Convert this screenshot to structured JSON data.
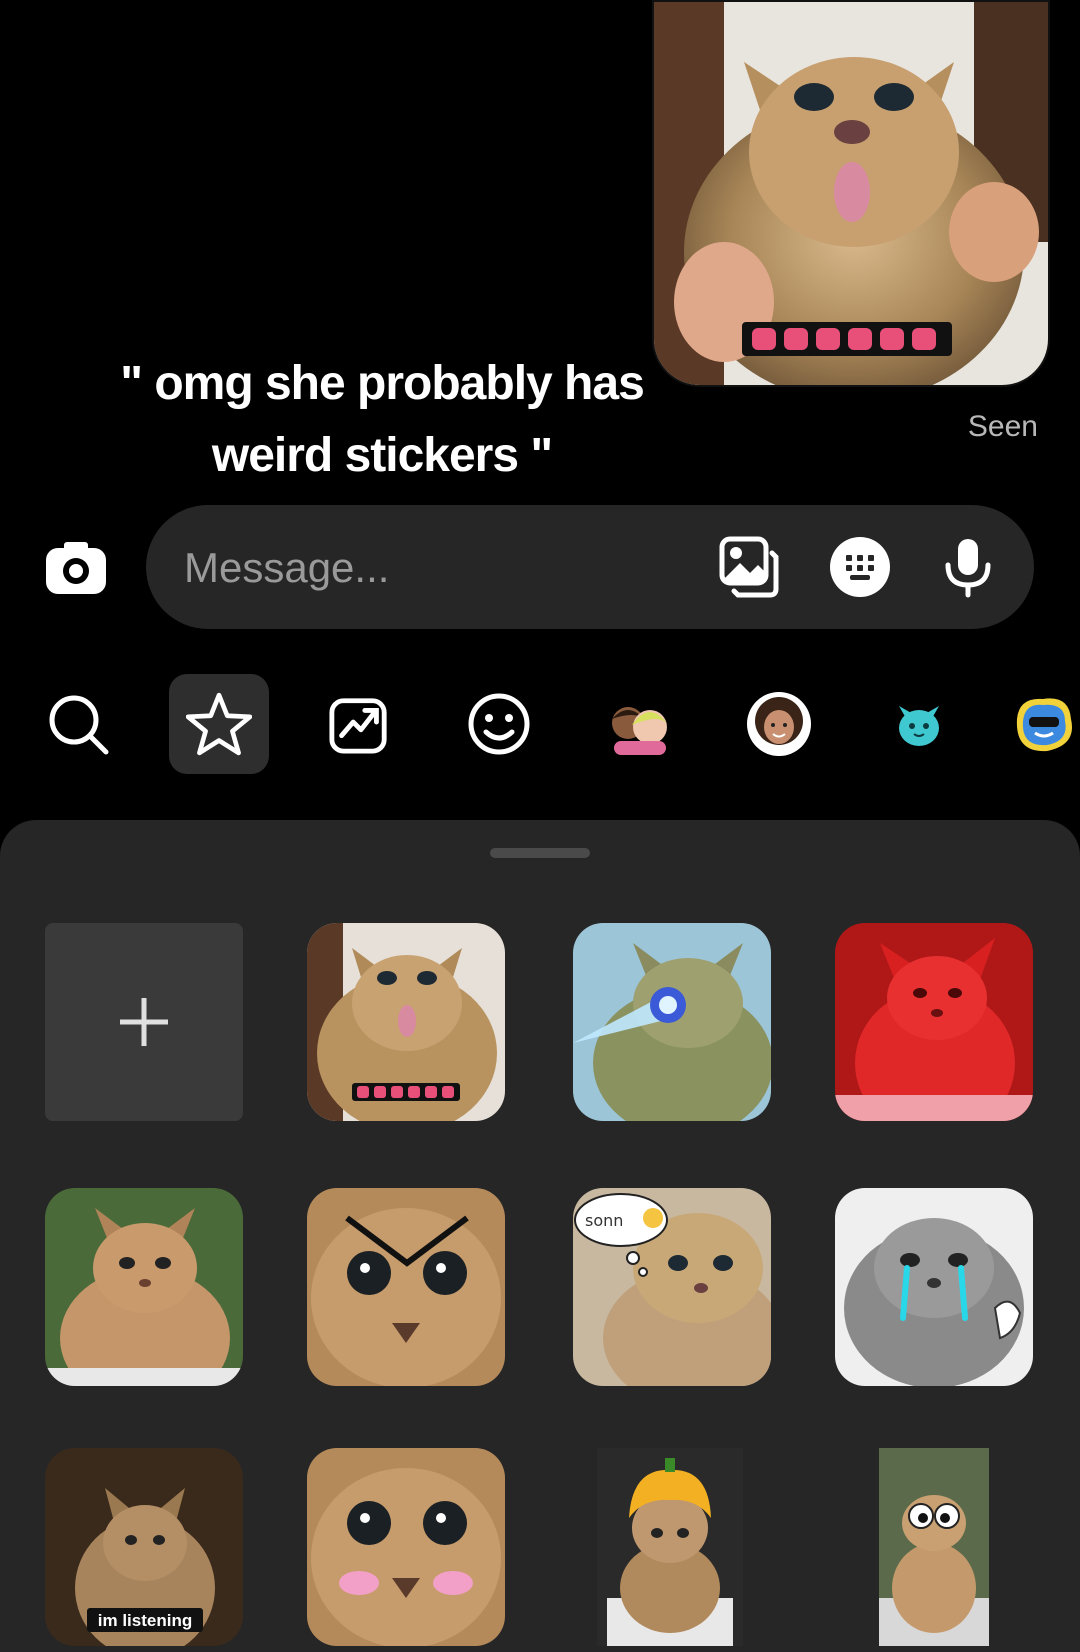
{
  "caption": {
    "line1": "\" omg she probably has",
    "line2": "weird stickers \""
  },
  "thread": {
    "seen_label": "Seen"
  },
  "composer": {
    "placeholder": "Message..."
  },
  "tabs": [
    {
      "name": "search",
      "icon": "search-icon"
    },
    {
      "name": "favorites",
      "icon": "star-icon",
      "active": true
    },
    {
      "name": "trending",
      "icon": "trending-icon"
    },
    {
      "name": "emoji",
      "icon": "smiley-icon"
    },
    {
      "name": "avatars-pair",
      "icon": "avatar-pair-icon"
    },
    {
      "name": "my-avatar",
      "icon": "avatar-icon"
    },
    {
      "name": "cat-pack",
      "icon": "cat-sticker-icon"
    },
    {
      "name": "monster-pack",
      "icon": "monster-sticker-icon"
    }
  ],
  "stickers": {
    "listening_label": "im listening",
    "thought_label": "sonn"
  },
  "colors": {
    "background": "#000000",
    "panel": "#262626",
    "input": "#262626",
    "active_tab": "#2e2e2e"
  }
}
